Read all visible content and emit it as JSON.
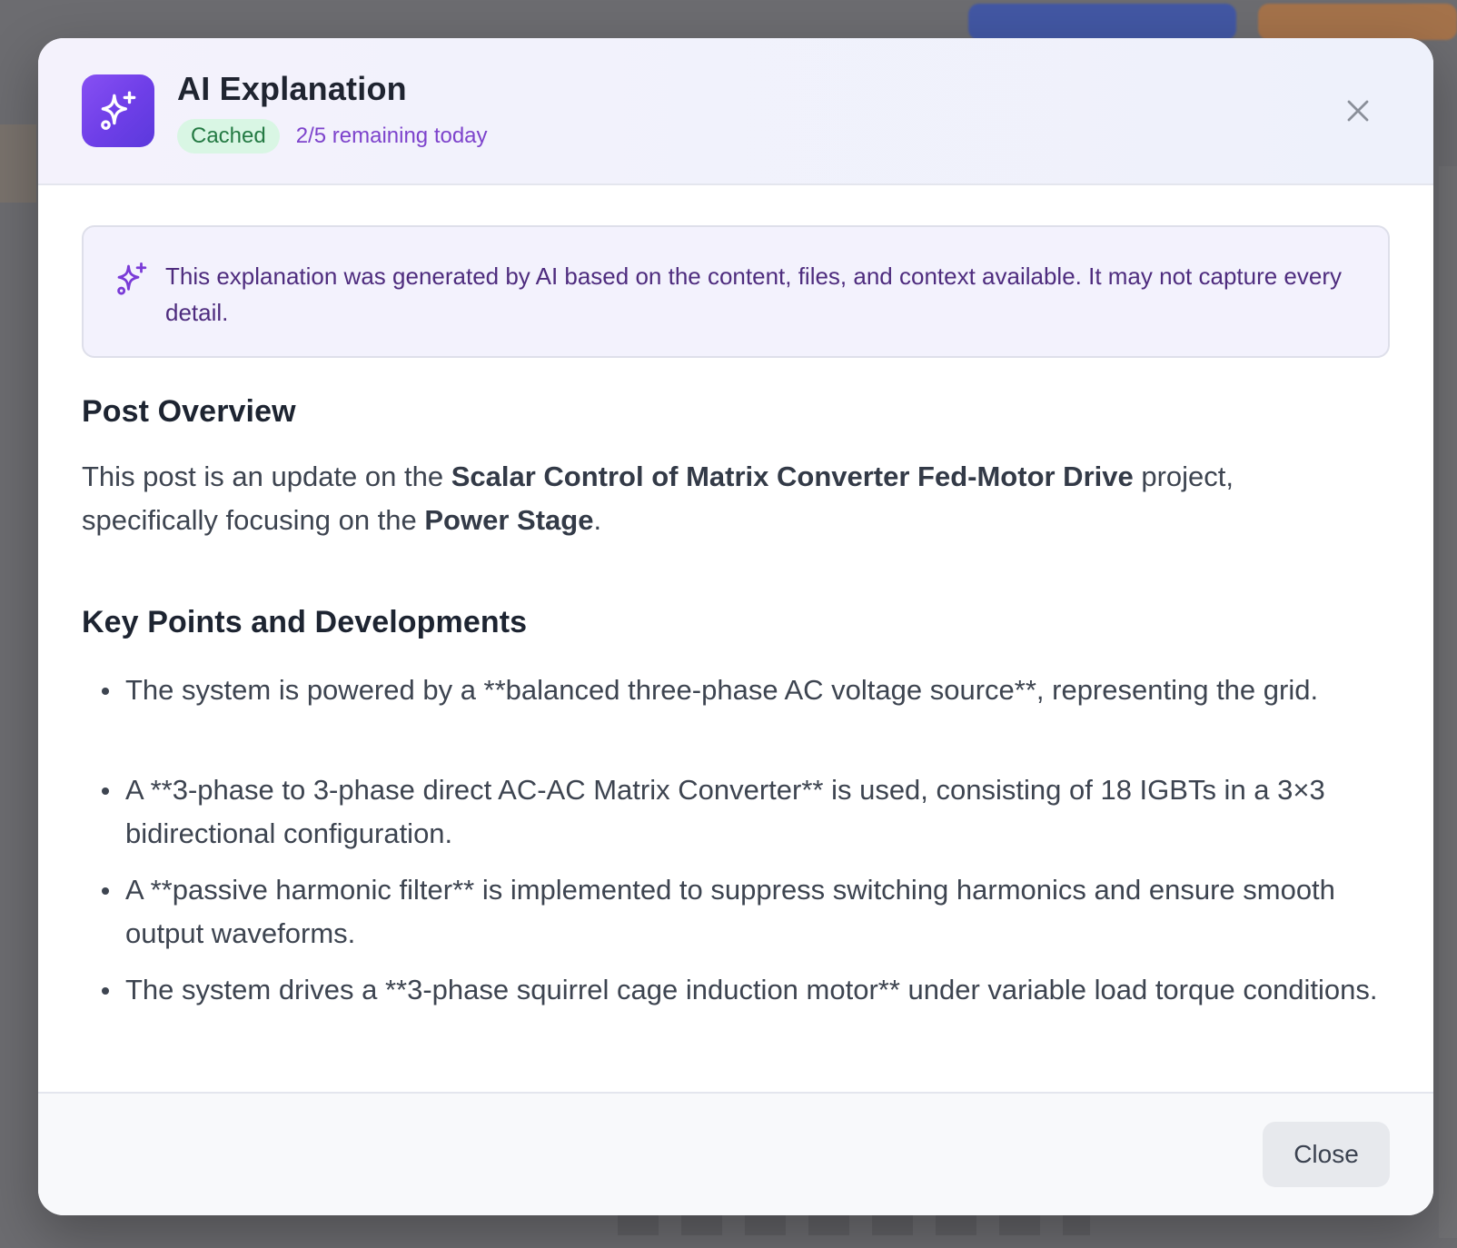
{
  "modal": {
    "title": "AI Explanation",
    "cached_badge": "Cached",
    "remaining_text": "2/5 remaining today",
    "icons": {
      "header": "sparkles-icon",
      "notice": "sparkles-icon",
      "close": "close-icon"
    }
  },
  "notice": {
    "text": "This explanation was generated by AI based on the content, files, and context available. It may not capture every detail."
  },
  "post_overview": {
    "title": "Post Overview",
    "prefix": "This post is an update on the ",
    "project": "Scalar Control of Matrix Converter Fed-Motor Drive",
    "middle": " project, specifically focusing on the ",
    "focus": "Power Stage",
    "suffix": "."
  },
  "key_points": {
    "title": "Key Points and Developments",
    "items": [
      "The system is powered by a **balanced three-phase AC voltage source**, representing the grid.",
      "A **3-phase to 3-phase direct AC-AC Matrix Converter** is used, consisting of 18 IGBTs in a 3×3 bidirectional configuration.",
      "A **passive harmonic filter** is implemented to suppress switching harmonics and ensure smooth output waveforms.",
      "The system drives a **3-phase squirrel cage induction motor** under variable load torque conditions."
    ]
  },
  "footer": {
    "close_label": "Close"
  },
  "colors": {
    "accent_purple": "#6f3fe8",
    "cached_green": "#247a43",
    "notice_text": "#4e2c7e"
  }
}
